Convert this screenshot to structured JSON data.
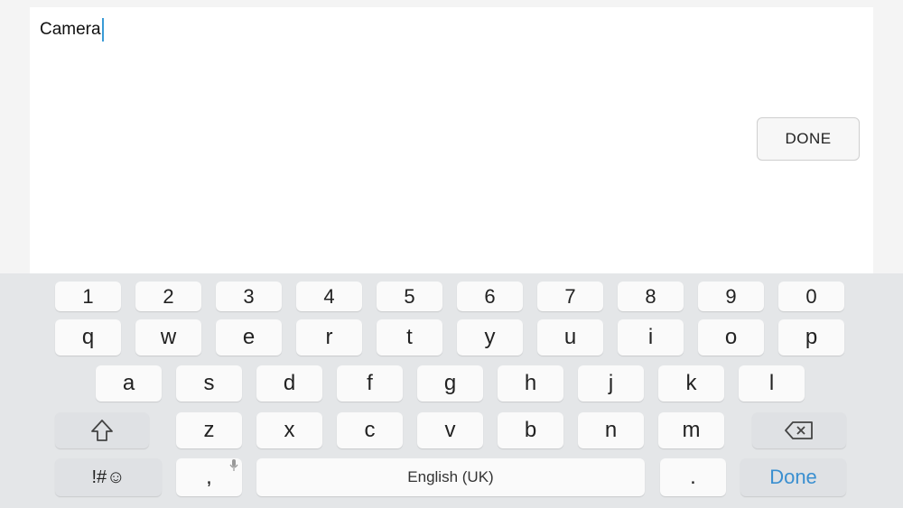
{
  "editor": {
    "text_value": "Camera",
    "done_label": "DONE"
  },
  "keyboard": {
    "number_row": [
      "1",
      "2",
      "3",
      "4",
      "5",
      "6",
      "7",
      "8",
      "9",
      "0"
    ],
    "row1": [
      "q",
      "w",
      "e",
      "r",
      "t",
      "y",
      "u",
      "i",
      "o",
      "p"
    ],
    "row2": [
      "a",
      "s",
      "d",
      "f",
      "g",
      "h",
      "j",
      "k",
      "l"
    ],
    "row3": [
      "z",
      "x",
      "c",
      "v",
      "b",
      "n",
      "m"
    ],
    "symbols_label": "!#☺",
    "comma_label": ",",
    "space_label": "English (UK)",
    "period_label": ".",
    "done_label": "Done",
    "accent_color": "#3a8fd0"
  }
}
